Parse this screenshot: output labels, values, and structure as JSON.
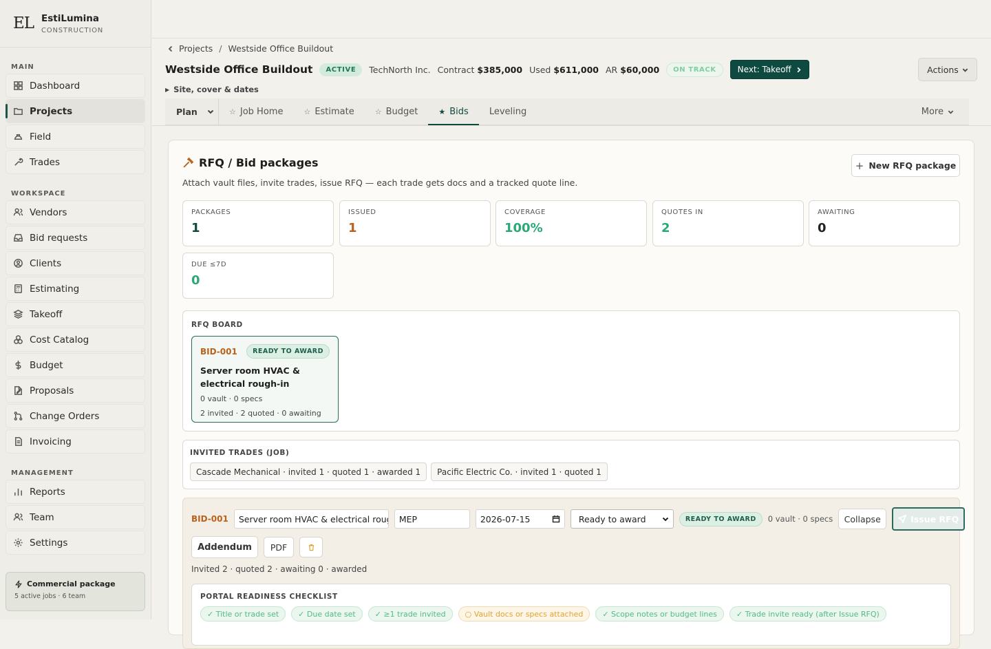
{
  "brand": {
    "mark": "EL",
    "name": "EstiLumina",
    "sub": "CONSTRUCTION"
  },
  "sidebar": {
    "main_label": "MAIN",
    "main": [
      {
        "label": "Dashboard",
        "icon": "grid-icon"
      },
      {
        "label": "Projects",
        "icon": "folder-icon",
        "active": true
      },
      {
        "label": "Field",
        "icon": "hardhat-icon"
      },
      {
        "label": "Trades",
        "icon": "wrench-icon"
      }
    ],
    "workspace_label": "WORKSPACE",
    "workspace": [
      {
        "label": "Vendors",
        "icon": "users-icon"
      },
      {
        "label": "Bid requests",
        "icon": "inbox-icon"
      },
      {
        "label": "Clients",
        "icon": "user-circle-icon"
      },
      {
        "label": "Estimating",
        "icon": "calculator-icon"
      },
      {
        "label": "Takeoff",
        "icon": "layers-icon"
      },
      {
        "label": "Cost Catalog",
        "icon": "boxes-icon"
      },
      {
        "label": "Budget",
        "icon": "dollar-icon"
      },
      {
        "label": "Proposals",
        "icon": "document-edit-icon"
      },
      {
        "label": "Change Orders",
        "icon": "git-branch-icon"
      },
      {
        "label": "Invoicing",
        "icon": "receipt-icon"
      }
    ],
    "management_label": "MANAGEMENT",
    "management": [
      {
        "label": "Reports",
        "icon": "bar-chart-icon"
      },
      {
        "label": "Team",
        "icon": "team-icon"
      },
      {
        "label": "Settings",
        "icon": "gear-icon"
      }
    ],
    "promo": {
      "title": "Commercial package",
      "sub": "5 active jobs · 6 team"
    }
  },
  "breadcrumb": {
    "parent": "Projects",
    "sep": "/",
    "current": "Westside Office Buildout"
  },
  "header": {
    "title": "Westside Office Buildout",
    "status": "ACTIVE",
    "client": "TechNorth Inc.",
    "contract_label": "Contract",
    "contract": "$385,000",
    "used_label": "Used",
    "used": "$611,000",
    "ar_label": "AR",
    "ar": "$60,000",
    "track": "ON TRACK",
    "next": "Next: Takeoff",
    "actions": "Actions",
    "site_toggle": "Site, cover & dates"
  },
  "tabs": {
    "plan": "Plan",
    "items": [
      {
        "label": "Job Home"
      },
      {
        "label": "Estimate"
      },
      {
        "label": "Budget"
      },
      {
        "label": "Bids",
        "active": true
      },
      {
        "label": "Leveling"
      }
    ],
    "more": "More"
  },
  "rfq": {
    "title": "RFQ / Bid packages",
    "subtitle": "Attach vault files, invite trades, issue RFQ — each trade gets docs and a tracked quote line.",
    "new_button": "New RFQ package",
    "stats": [
      {
        "label": "PACKAGES",
        "value": "1",
        "color": "#0f4a40"
      },
      {
        "label": "ISSUED",
        "value": "1",
        "color": "#b9621c"
      },
      {
        "label": "COVERAGE",
        "value": "100%",
        "color": "#2aa876"
      },
      {
        "label": "QUOTES IN",
        "value": "2",
        "color": "#2aa876"
      },
      {
        "label": "AWAITING",
        "value": "0",
        "color": "#222222"
      },
      {
        "label": "DUE ≤7D",
        "value": "0",
        "color": "#2aa876"
      }
    ],
    "board_label": "RFQ BOARD",
    "board_card": {
      "id": "BID-001",
      "status": "READY TO AWARD",
      "name": "Server room HVAC & electrical rough-in",
      "files": "0 vault · 0 specs",
      "counts": "2 invited · 2 quoted · 0 awaiting"
    },
    "invited_label": "INVITED TRADES (JOB)",
    "invited": [
      "Cascade Mechanical · invited 1 · quoted 1 · awarded 1",
      "Pacific Electric Co. · invited 1 · quoted 1"
    ],
    "editor": {
      "id": "BID-001",
      "name": "Server room HVAC & electrical rough-in",
      "trade": "MEP",
      "due": "2026-07-15",
      "status_select": "Ready to award",
      "status_pill": "READY TO AWARD",
      "files": "0 vault · 0 specs",
      "collapse": "Collapse",
      "issue": "Issue RFQ",
      "addendum": "Addendum",
      "pdf": "PDF",
      "summary": "Invited 2 · quoted 2 · awaiting 0 · awarded",
      "checklist_label": "PORTAL READINESS CHECKLIST",
      "checklist": [
        {
          "text": "✓ Title or trade set",
          "ok": true
        },
        {
          "text": "✓ Due date set",
          "ok": true
        },
        {
          "text": "✓ ≥1 trade invited",
          "ok": true
        },
        {
          "text": "○ Vault docs or specs attached",
          "ok": false
        },
        {
          "text": "✓ Scope notes or budget lines",
          "ok": true
        },
        {
          "text": "✓ Trade invite ready (after Issue RFQ)",
          "ok": true
        }
      ]
    }
  }
}
